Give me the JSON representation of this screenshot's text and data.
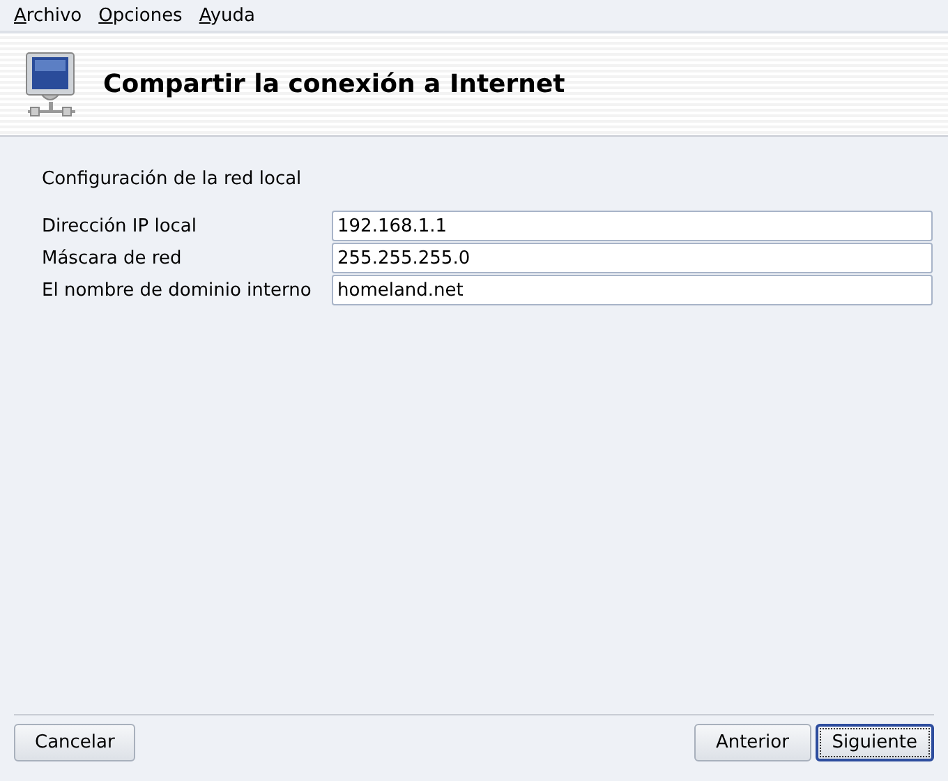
{
  "menu": [
    "Archivo",
    "Opciones",
    "Ayuda"
  ],
  "header": {
    "title": "Compartir la conexión a Internet"
  },
  "section_label": "Configuración de la red local",
  "fields": [
    {
      "label": "Dirección IP local",
      "value": "192.168.1.1"
    },
    {
      "label": "Máscara de red",
      "value": "255.255.255.0"
    },
    {
      "label": "El nombre de dominio interno",
      "value": "homeland.net"
    }
  ],
  "left_buttons": [
    {
      "label": "Cancelar",
      "focused": false
    }
  ],
  "right_buttons": [
    {
      "label": "Anterior",
      "focused": false
    },
    {
      "label": "Siguiente",
      "focused": true
    }
  ]
}
